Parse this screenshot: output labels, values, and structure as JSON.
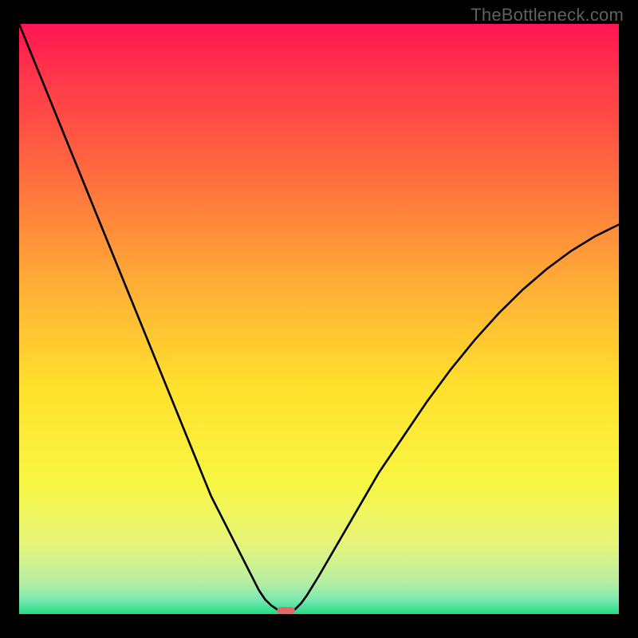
{
  "watermark": "TheBottleneck.com",
  "chart_data": {
    "type": "line",
    "title": "",
    "xlabel": "",
    "ylabel": "",
    "xlim": [
      0,
      100
    ],
    "ylim": [
      0,
      100
    ],
    "x": [
      0,
      2,
      4,
      6,
      8,
      10,
      12,
      14,
      16,
      18,
      20,
      22,
      24,
      26,
      28,
      30,
      32,
      34,
      36,
      38,
      40,
      41,
      42,
      43,
      44,
      44.5,
      45,
      46,
      47,
      48,
      50,
      52,
      54,
      56,
      58,
      60,
      64,
      68,
      72,
      76,
      80,
      84,
      88,
      92,
      96,
      100
    ],
    "values": [
      100,
      95,
      90,
      85,
      80,
      75,
      70,
      65,
      60,
      55,
      50,
      45,
      40,
      35,
      30,
      25,
      20,
      16,
      12,
      8,
      4,
      2.5,
      1.5,
      0.8,
      0.3,
      0.2,
      0.3,
      0.8,
      1.8,
      3.2,
      6.5,
      10,
      13.5,
      17,
      20.5,
      24,
      30,
      36,
      41.5,
      46.5,
      51,
      55,
      58.5,
      61.5,
      64,
      66
    ],
    "dip_marker": {
      "x": 44.5,
      "width": 3,
      "height": 1.2,
      "color": "#e06868"
    },
    "gradient_stops": [
      {
        "offset": 0.0,
        "color": "#ff1552"
      },
      {
        "offset": 0.1,
        "color": "#ff3a4a"
      },
      {
        "offset": 0.25,
        "color": "#ff6a3f"
      },
      {
        "offset": 0.45,
        "color": "#ffb035"
      },
      {
        "offset": 0.62,
        "color": "#ffe22d"
      },
      {
        "offset": 0.78,
        "color": "#f8f644"
      },
      {
        "offset": 0.88,
        "color": "#e6f57a"
      },
      {
        "offset": 0.945,
        "color": "#b8eea2"
      },
      {
        "offset": 0.975,
        "color": "#7de8b1"
      },
      {
        "offset": 1.0,
        "color": "#1fdc82"
      }
    ]
  }
}
